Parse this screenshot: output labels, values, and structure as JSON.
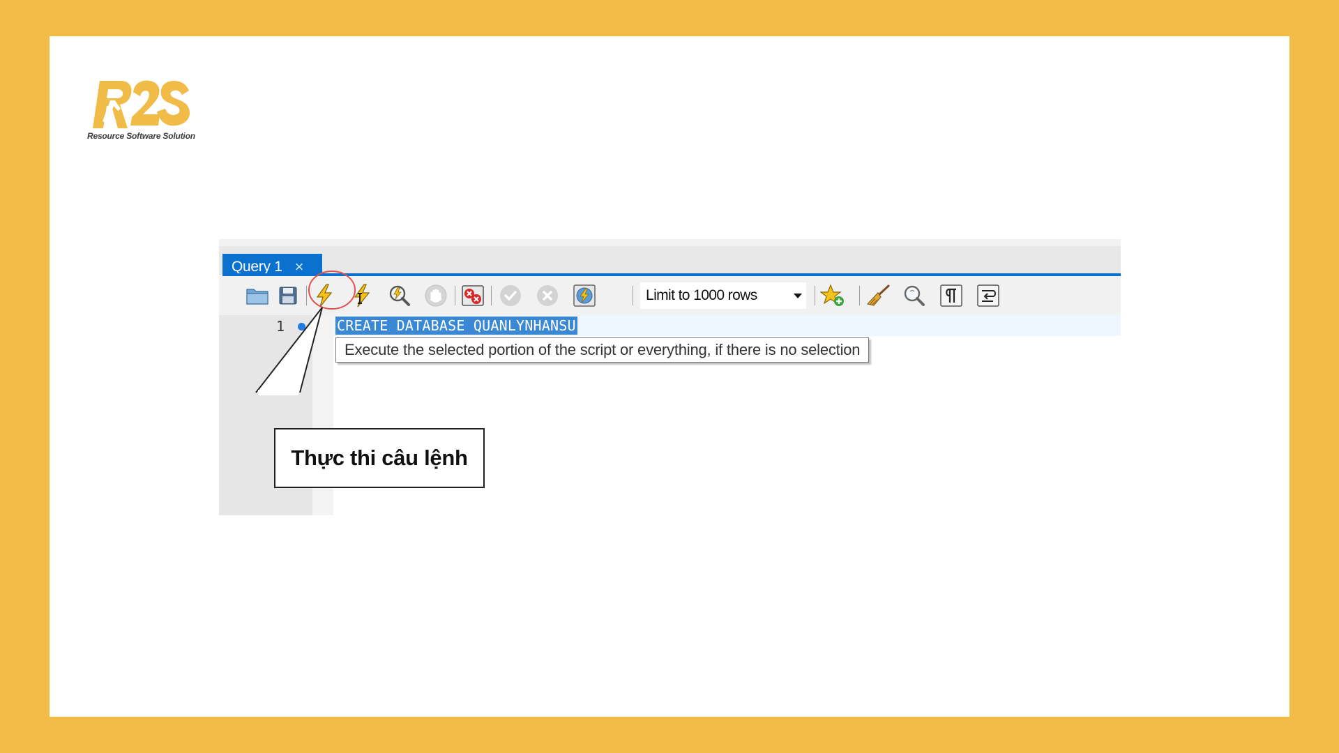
{
  "logo": {
    "brand": "R2S",
    "tagline": "Resource Software Solution",
    "brand_color": "#F0BB46"
  },
  "editor_tab": {
    "label": "Query 1",
    "close_glyph": "×"
  },
  "toolbar": {
    "buttons": [
      {
        "id": "open",
        "icon": "folder-icon"
      },
      {
        "id": "save",
        "icon": "save-icon"
      },
      {
        "id": "execute",
        "icon": "lightning-icon"
      },
      {
        "id": "execute-current",
        "icon": "lightning-cursor-icon"
      },
      {
        "id": "explain",
        "icon": "magnifier-icon"
      },
      {
        "id": "stop",
        "icon": "stop-hand-icon"
      },
      {
        "id": "toggle-errors",
        "icon": "error-toggle-icon"
      },
      {
        "id": "commit",
        "icon": "check-icon"
      },
      {
        "id": "rollback",
        "icon": "cancel-icon"
      },
      {
        "id": "autocommit",
        "icon": "autocommit-icon"
      },
      {
        "id": "add-snippet",
        "icon": "star-add-icon"
      },
      {
        "id": "beautify",
        "icon": "broom-icon"
      },
      {
        "id": "find",
        "icon": "find-icon"
      },
      {
        "id": "invisibles",
        "icon": "pilcrow-icon"
      },
      {
        "id": "wrap",
        "icon": "word-wrap-icon"
      }
    ],
    "limit_select": {
      "selected": "Limit to 1000 rows"
    }
  },
  "editor": {
    "line_number": "1",
    "code": "CREATE DATABASE QUANLYNHANSU",
    "tooltip": "Execute the selected portion of the script or everything, if there is no selection"
  },
  "callout": {
    "text": "Thực thi câu lệnh",
    "highlight_color": "#E05050"
  },
  "colors": {
    "frame": "#F3BB48",
    "accent_blue": "#0A72CE",
    "selection": "#3A88D4"
  }
}
